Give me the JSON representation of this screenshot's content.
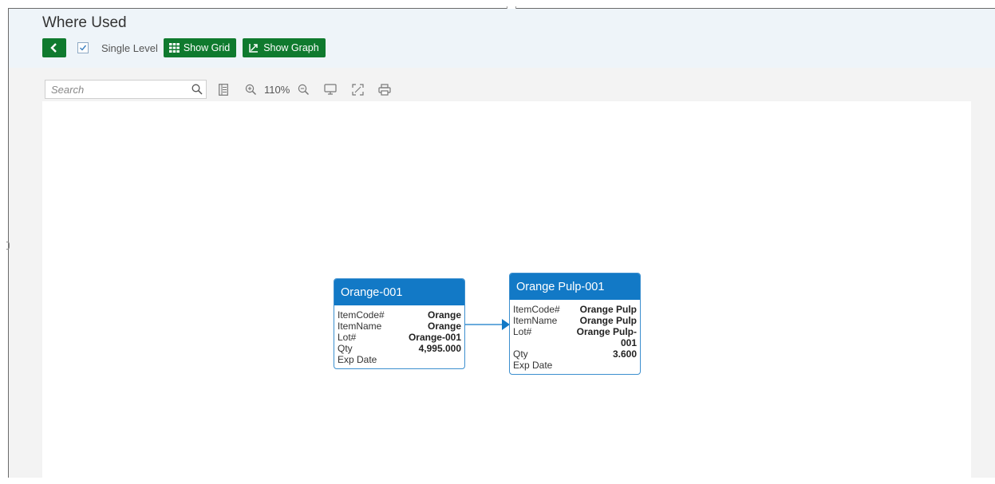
{
  "header": {
    "title": "Where Used",
    "single_level_label": "Single Level",
    "single_level_checked": true,
    "show_grid_label": "Show Grid",
    "show_graph_label": "Show Graph"
  },
  "viewer_toolbar": {
    "search_placeholder": "Search",
    "zoom_level": "110%"
  },
  "icons": [
    "back-arrow-icon",
    "check-icon",
    "grid-icon",
    "graph-icon",
    "search-icon",
    "list-icon",
    "zoom-in-icon",
    "zoom-out-icon",
    "monitor-icon",
    "fullscreen-icon",
    "print-icon"
  ],
  "colors": {
    "accent_green": "#0f7a2e",
    "node_header_blue": "#1279c6",
    "node_border": "#3c8fcf",
    "header_bg": "#eef4f9"
  },
  "nodes": [
    {
      "title": "Orange-001",
      "fields": [
        {
          "label": "ItemCode#",
          "value": "Orange"
        },
        {
          "label": "ItemName",
          "value": "Orange"
        },
        {
          "label": "Lot#",
          "value": "Orange-001"
        },
        {
          "label": "Qty",
          "value": "4,995.000"
        },
        {
          "label": "Exp Date",
          "value": ""
        }
      ]
    },
    {
      "title": "Orange Pulp-001",
      "fields": [
        {
          "label": "ItemCode#",
          "value": "Orange Pulp"
        },
        {
          "label": "ItemName",
          "value": "Orange Pulp"
        },
        {
          "label": "Lot#",
          "value": "Orange Pulp-001"
        },
        {
          "label": "Qty",
          "value": "3.600"
        },
        {
          "label": "Exp Date",
          "value": ""
        }
      ]
    }
  ]
}
